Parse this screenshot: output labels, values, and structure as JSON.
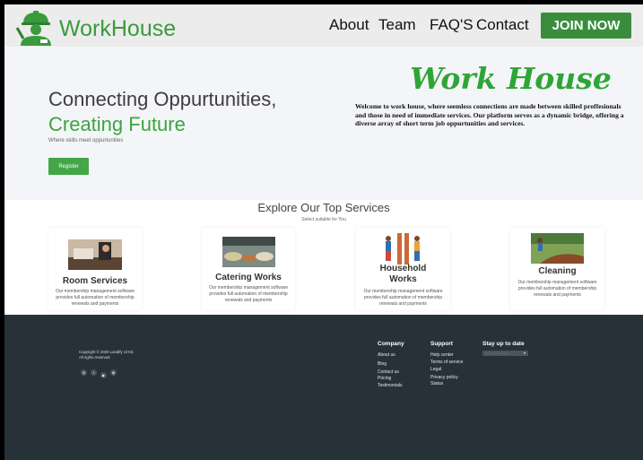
{
  "header": {
    "brand": "WorkHouse",
    "nav": [
      "About",
      "Team",
      "FAQ'S",
      "Contact"
    ],
    "join_label": "JOIN NOW"
  },
  "hero": {
    "headline_line1": "Connecting Oppurtunities,",
    "headline_line2": "Creating Future",
    "tagline": "Where skills meet oppurtunities",
    "register_label": "Register",
    "title": "Work House",
    "paragraph": "Welcome to work house, where seemless connections are made between skilled proffesionals and those in need of immediate services.  Our platform serves as a dynamic bridge, offering a diverse array of short term job oppurtunities and services."
  },
  "services": {
    "title": "Explore Our Top Services",
    "subtitle": "Select suitable for You",
    "cards": [
      {
        "title": "Room Services",
        "desc": "Our membership management software provides full automation of membership renewals and payments"
      },
      {
        "title": "Catering Works",
        "desc": "Our membership management software provides full automation of membership renewals and payments"
      },
      {
        "title": "Household Works",
        "desc": "Our membership management software provides full automation of membership renewals and payments"
      },
      {
        "title": "Cleaning",
        "desc": "Our membership management software provides full automation of membership renewals and payments"
      }
    ]
  },
  "footer": {
    "copyright_line1": "Copyright © 2020 Landify UI Kit.",
    "copyright_line2": "All rights reserved",
    "company": {
      "heading": "Company",
      "links": [
        "About us",
        "Blog",
        "Contact us",
        "Pricing",
        "Testimonials"
      ]
    },
    "support": {
      "heading": "Support",
      "links": [
        "Help center",
        "Terms of service",
        "Legal",
        "Privacy policy",
        "Status"
      ]
    },
    "newsletter": {
      "heading": "Stay up to date",
      "placeholder": "Your email address"
    }
  },
  "colors": {
    "brand_green": "#3a9a3c",
    "footer_bg": "#263238",
    "hero_bg": "#f4f5f8"
  }
}
